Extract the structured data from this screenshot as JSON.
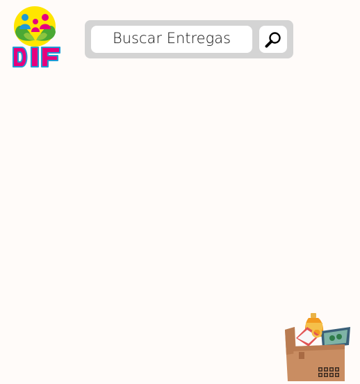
{
  "header": {
    "logo_icon": "dif-family-logo-icon"
  },
  "search": {
    "placeholder": "Buscar Entregas",
    "value": "",
    "button_icon": "magnifier-icon"
  },
  "decoration": {
    "illustration_icon": "grocery-box-icon"
  },
  "colors": {
    "background": "#fffbf9",
    "search_bar": "#d4d4d4",
    "logo_yellow": "#ffe500",
    "logo_pink": "#e6007e",
    "logo_blue": "#1e9ad6",
    "logo_green": "#4aa934"
  }
}
